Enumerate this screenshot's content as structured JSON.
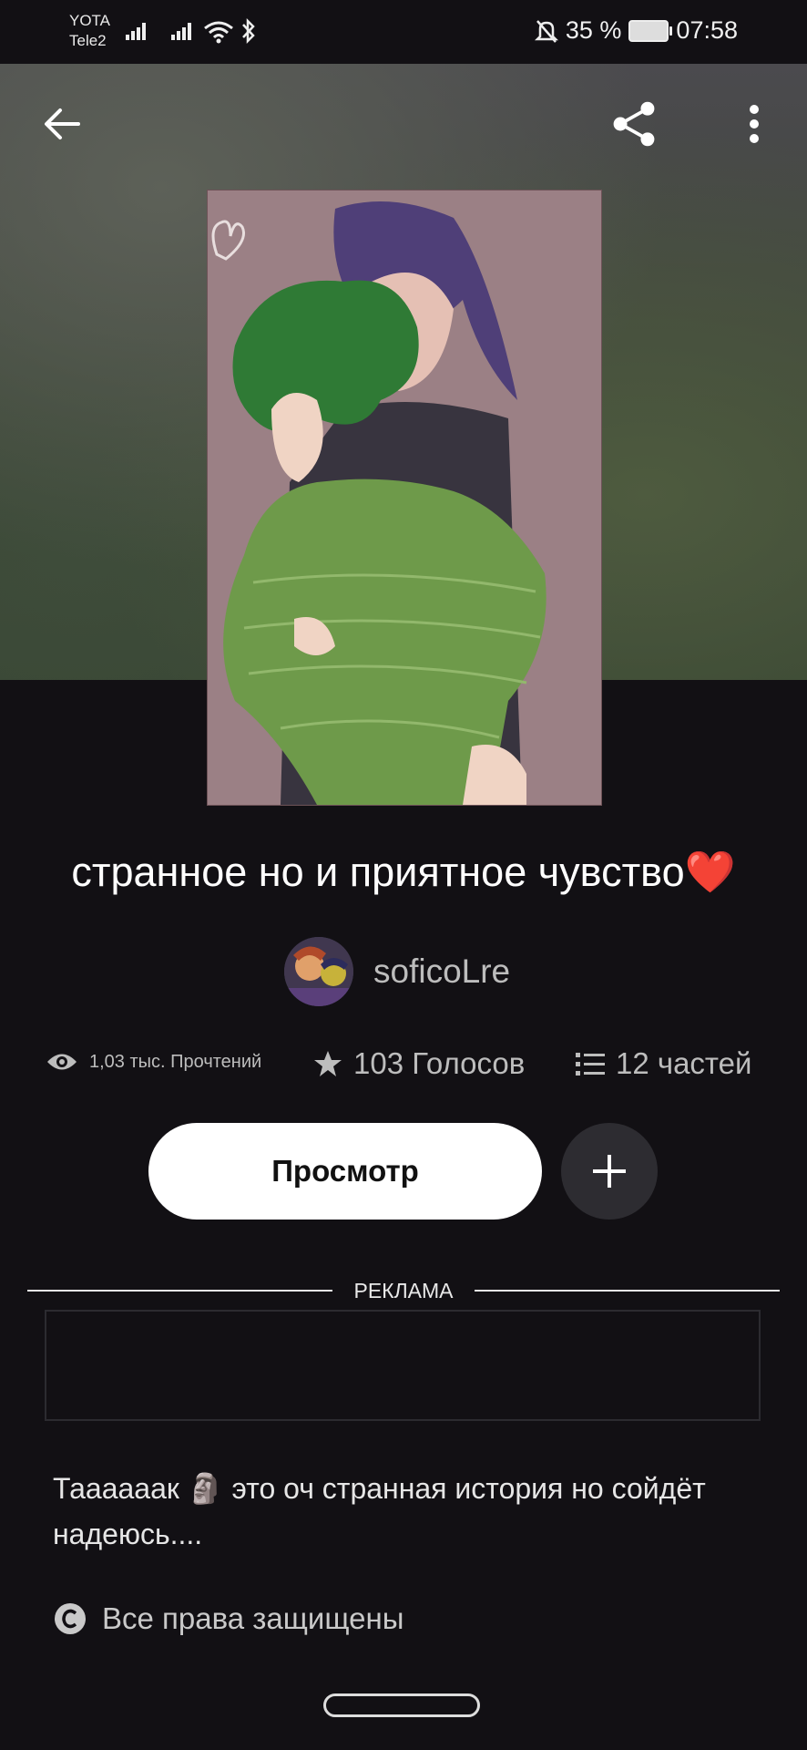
{
  "status_bar": {
    "carrier_1": "YOTA",
    "carrier_2": "Tele2",
    "battery_percent": "35 %",
    "time": "07:58"
  },
  "topbar": {
    "back_icon": "arrow-left-icon",
    "share_icon": "share-icon",
    "menu_icon": "more-vertical-icon"
  },
  "story": {
    "title": "странное но и приятное чувство❤️",
    "author": "soficoLre",
    "description": "Таааааак 🗿 это оч странная история но сойдёт надеюсь....",
    "rights": "Все права защищены"
  },
  "stats": {
    "reads": "1,03 тыс. Прочтений",
    "votes": "103 Голосов",
    "parts": "12 частей"
  },
  "actions": {
    "read_label": "Просмотр",
    "add_icon": "plus-icon"
  },
  "ad": {
    "label": "РЕКЛАМА"
  },
  "colors": {
    "background": "#121014",
    "button_bg": "#ffffff",
    "add_button_bg": "#2d2c31"
  }
}
